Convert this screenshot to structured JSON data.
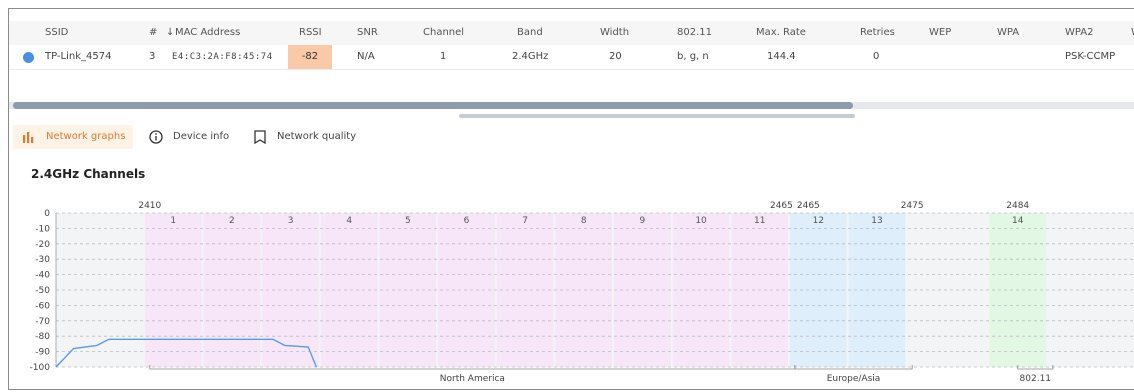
{
  "table": {
    "columns": [
      "SSID",
      "#",
      "MAC Address",
      "RSSI",
      "SNR",
      "Channel",
      "Band",
      "Width",
      "802.11",
      "Max. Rate",
      "Retries",
      "WEP",
      "WPA",
      "WPA2",
      "W"
    ],
    "sort_column": "MAC Address",
    "rows": [
      {
        "ssid": "TP-Link_4574",
        "index": "3",
        "mac": "E4:C3:2A:F8:45:74",
        "rssi": "-82",
        "snr": "N/A",
        "channel": "1",
        "band": "2.4GHz",
        "width": "20",
        "protocol": "b, g, n",
        "max_rate": "144.4",
        "retries": "0",
        "wep": "",
        "wpa": "",
        "wpa2": "PSK-CCMP",
        "status_color": "#4a8fe2"
      }
    ]
  },
  "tabs": [
    {
      "label": "Network graphs",
      "icon": "bar-chart-icon",
      "active": true
    },
    {
      "label": "Device info",
      "icon": "info-icon",
      "active": false
    },
    {
      "label": "Network quality",
      "icon": "bookmark-icon",
      "active": false
    }
  ],
  "chart_title": "2.4GHz Channels",
  "chart_data": {
    "type": "area",
    "title": "2.4GHz Channels",
    "ylim": [
      -100,
      0
    ],
    "yticks": [
      0,
      -10,
      -20,
      -30,
      -40,
      -50,
      -60,
      -70,
      -80,
      -90,
      -100
    ],
    "xlim": [
      2402,
      2494
    ],
    "grid": true,
    "frequency_labels": [
      {
        "freq": 2410,
        "label": "2410"
      },
      {
        "freq": 2465,
        "label": "2465",
        "align": "end"
      },
      {
        "freq": 2465,
        "label": "2465",
        "align": "start"
      },
      {
        "freq": 2475,
        "label": "2475"
      },
      {
        "freq": 2484,
        "label": "2484"
      }
    ],
    "channels": [
      {
        "label": "1",
        "freq": 2412,
        "region": "na"
      },
      {
        "label": "2",
        "freq": 2417,
        "region": "na"
      },
      {
        "label": "3",
        "freq": 2422,
        "region": "na"
      },
      {
        "label": "4",
        "freq": 2427,
        "region": "na"
      },
      {
        "label": "5",
        "freq": 2432,
        "region": "na"
      },
      {
        "label": "6",
        "freq": 2437,
        "region": "na"
      },
      {
        "label": "7",
        "freq": 2442,
        "region": "na"
      },
      {
        "label": "8",
        "freq": 2447,
        "region": "na"
      },
      {
        "label": "9",
        "freq": 2452,
        "region": "na"
      },
      {
        "label": "10",
        "freq": 2457,
        "region": "na"
      },
      {
        "label": "11",
        "freq": 2462,
        "region": "na"
      },
      {
        "label": "12",
        "freq": 2467,
        "region": "eu"
      },
      {
        "label": "13",
        "freq": 2472,
        "region": "eu"
      },
      {
        "label": "14",
        "freq": 2484,
        "region": "jp"
      }
    ],
    "regions": [
      {
        "label": "North America",
        "from": 2410,
        "to": 2465
      },
      {
        "label": "Europe/Asia",
        "from": 2465,
        "to": 2475
      },
      {
        "label": "802.11",
        "from": 2484,
        "to": 2487
      }
    ],
    "series": [
      {
        "color": "#5b9be6",
        "points": [
          [
            2402,
            -100
          ],
          [
            2403.5,
            -88
          ],
          [
            2405.5,
            -86
          ],
          [
            2406.5,
            -82
          ],
          [
            2420.5,
            -82
          ],
          [
            2421.5,
            -86
          ],
          [
            2423.5,
            -87
          ],
          [
            2424.2,
            -100
          ]
        ]
      }
    ],
    "colors": {
      "na": "#f7e6f8",
      "eu": "#dfeefb",
      "jp": "#e2f8e4",
      "empty": "#f3f4f6"
    }
  }
}
